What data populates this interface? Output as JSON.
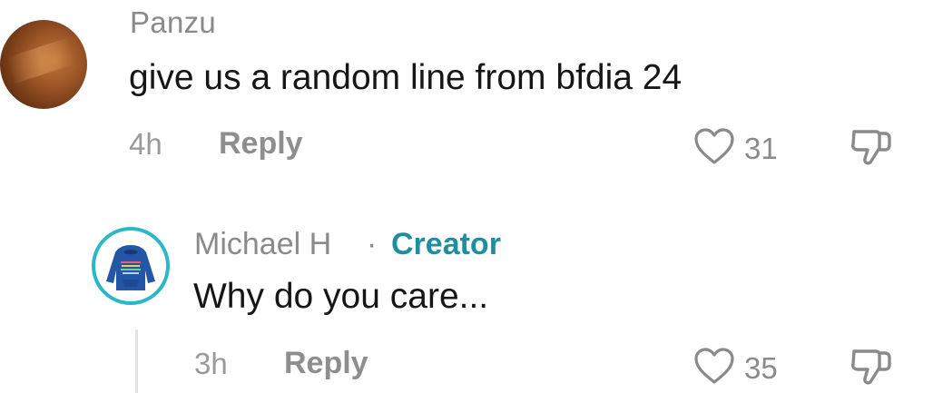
{
  "comments": [
    {
      "username": "Panzu",
      "text": "give us a random line from bfdia 24",
      "time": "4h",
      "reply_label": "Reply",
      "likes": "31",
      "avatar_icon": "profile-photo-orange"
    },
    {
      "username": "Michael H",
      "separator": "·",
      "badge": "Creator",
      "text": "Why do you care...",
      "time": "3h",
      "reply_label": "Reply",
      "likes": "35",
      "avatar_icon": "blue-hoodie-avatar"
    }
  ],
  "icons": {
    "like": "heart-outline-icon",
    "dislike": "thumbs-down-outline-icon"
  },
  "colors": {
    "creator_badge": "#1e8ea1",
    "avatar_ring": "#2cb7c9",
    "muted_text": "#8a8a8a",
    "primary_text": "#161616"
  }
}
